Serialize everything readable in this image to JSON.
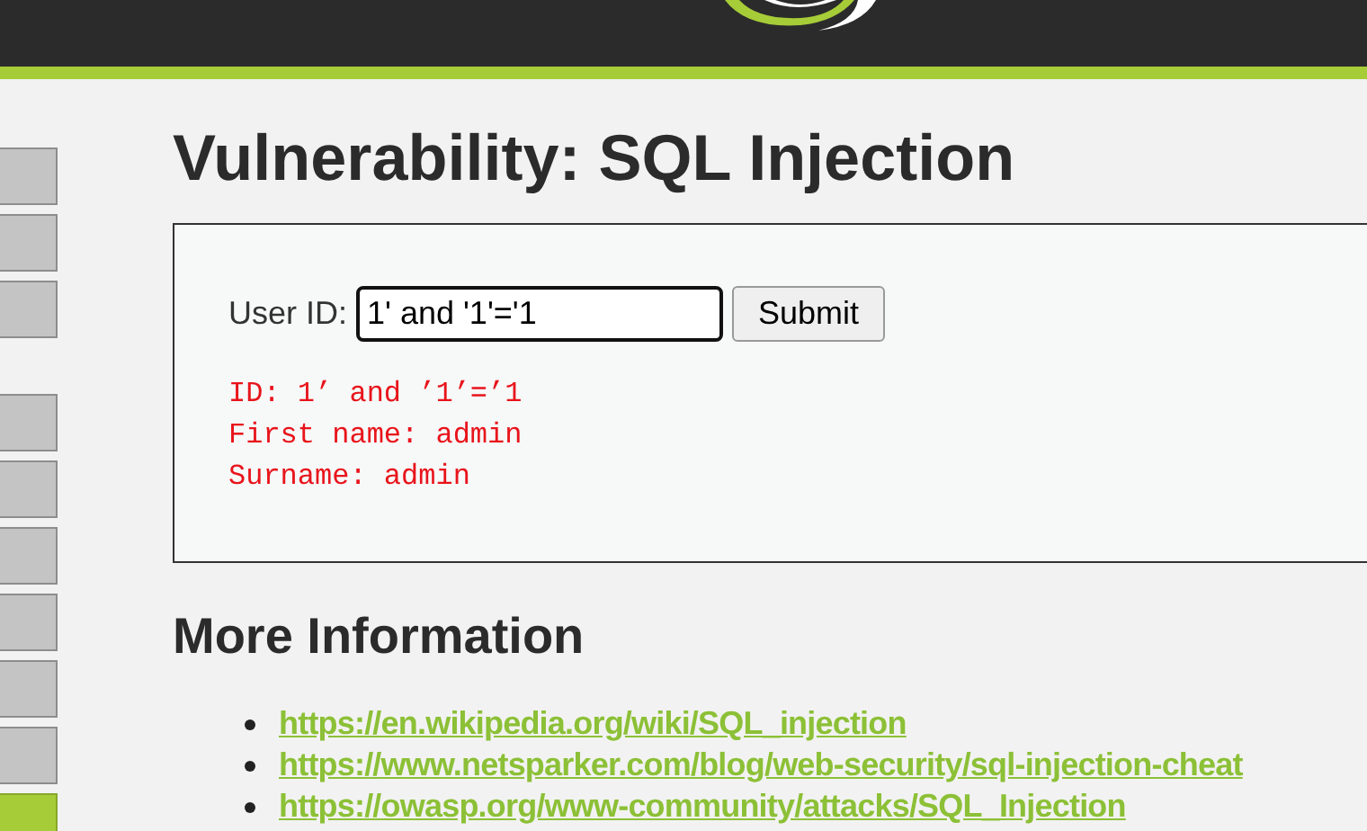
{
  "sidebar": {
    "groups": [
      {
        "items": [
          {
            "selected": false
          },
          {
            "selected": false
          },
          {
            "selected": false
          }
        ]
      },
      {
        "items": [
          {
            "selected": false
          },
          {
            "selected": false
          },
          {
            "selected": false
          },
          {
            "selected": false
          },
          {
            "selected": false
          },
          {
            "selected": false
          },
          {
            "selected": true
          }
        ]
      }
    ]
  },
  "title": "Vulnerability: SQL Injection",
  "form": {
    "label": "User ID:",
    "value": "1' and '1'='1",
    "button": "Submit"
  },
  "output": [
    "ID: 1’ and ’1’=’1",
    "First name: admin",
    "Surname: admin"
  ],
  "more_info": {
    "heading": "More Information",
    "links": [
      "https://en.wikipedia.org/wiki/SQL_injection",
      "https://www.netsparker.com/blog/web-security/sql-injection-cheat",
      "https://owasp.org/www-community/attacks/SQL_Injection"
    ]
  }
}
